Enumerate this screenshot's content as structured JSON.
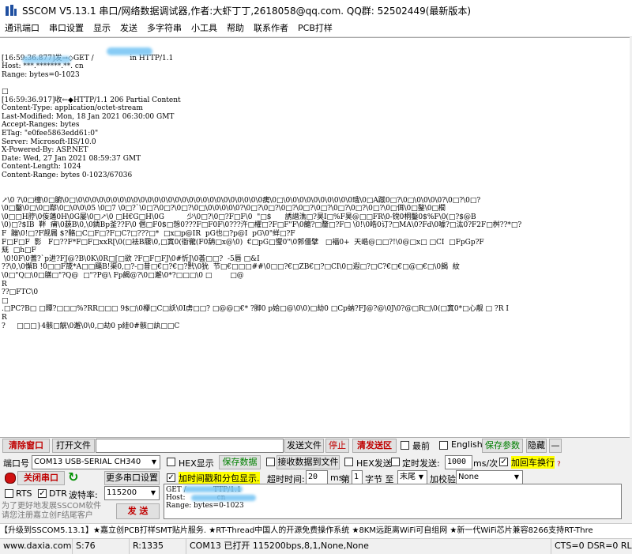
{
  "window": {
    "title": "SSCOM V5.13.1 串口/网络数据调试器,作者:大虾丁丁,2618058@qq.com. QQ群: 52502449(最新版本)"
  },
  "menu": [
    "通讯端口",
    "串口设置",
    "显示",
    "发送",
    "多字符串",
    "小工具",
    "帮助",
    "联系作者",
    "PCB打样"
  ],
  "terminal": {
    "lines": "\n[16:59:36.877]发→◇GET /                in HTTP/1.1\nHost: ***.*******.**. cn\nRange: bytes=0-1023\n\n□\n[16:59:36.917]收←◆HTTP/1.1 206 Partial Content\nContent-Type: application/octet-stream\nLast-Modified: Mon, 18 Jan 2021 06:30:00 GMT\nAccept-Ranges: bytes\nETag: \"e0fee5863edd61:0\"\nServer: Microsoft-IIS/10.0\nX-Powered-By: ASP.NET\nDate: Wed, 27 Jan 2021 08:59:37 GMT\nContent-Length: 1024\nContent-Range: bytes 0-1023/67036\n\n\n↗\\0 ?\\0□橦\\0□腑\\0□\\0\\0\\0\\0\\0\\0\\0\\0\\0\\0\\0\\0\\0\\0\\0\\0\\0\\0\\0\\0\\0\\0\\0\\0\\0\\0\\0痍\\0□\\0\\0\\0\\0\\0\\0\\0\\0\\0\\0珴\\0□A蹴0□?\\0□\\0\\0\\0\\0?\\0□?\\0□?\n\\0□鑿\\0□\\0□鄀\\0□\\0\\0\\05 \\0□7 \\0□?`\\0□?\\0□?\\0□?\\0□\\0\\0\\0\\0\\0?\\0□?\\0□?\\0□?\\0□?\\0□?\\0□?\\0□?\\0□?\\0□佴\\0□鏊\\0□櫚\n\\0□□H脝\\0侫蓪0H\\0G屡\\0□↗\\0 □H€G□H\\0G          少\\0□?\\0□?F□F\\0  \"□$      誘譛潐□?昊I□%F昊@□□FR\\0-镋0桐鑿0$%F\\0(□?$@B\n\\0)□?$IB  靽  痡\\0藐B\\0,\\0鏻Bp釜??F\\0 俋□F0$□愨0???F□F0F\\0???汻□欋□?F□F\"F\\0饝?□釐□?F□ \\0!\\0皓0订?□MA\\0?Fd\\0噱?□汯0?F2F□桝??*□?\nF  蹦\\0!□?F觊屚 $?骼□C□F□?F□C?□???□*  □x□p@IR  pG也□?p@I  pG\\0\"蛘□?F\nF□F□F  影   F□??F*F□F□xxR[\\0(□袪B屦\\0,□窴0(衜徿(F0舑□x@\\0)  €□pG□蠁0\"\\0郣僵擘   □褔0+  天峼@□□?!\\0@□x□ □CI  □FpGp?F\n兓  □h□F\n \\0!0F\\0蓍?`p进?FJ@?B\\0K\\0R□[□欲 ?F□F□FJ\\0#忻J\\0荟□□?  -5唇 □&I\n??\\0,\\0懈B !0□□F筬*A□□颾B!渠0,□?-□昔□€□?€□?黓\\0狁  节□€□□□##\\0□□?€□ZB€□?□CI\\0□遐□?□C?€□€□@□€□\\0餲  紋\n\\0□\"Q□\\0□膳□\"?Q@  □\"?P@\\ Fp餲@?\\0□邂\\0*?□□□\\0 □        □@\nR\n??□FTC\\0\n□\n.□PC?B□ □贉?□□□%?RR□□□ 9$□\\0欅□C□訞\\0I虏□□? □@@□€* ?脚0 p姶□@\\0\\0)□劫0 □Cp蚋?FJ@?@\\0J\\0?@□R□\\0(□窴0*□心靓 □ ?R I\nR\n?     □□□}4骸□觥\\0邂\\0\\0,□劫0 p絓0#骸□訙□□C\n"
  },
  "controls": {
    "clear_window": "清除窗口",
    "open_file": "打开文件",
    "send_file": "发送文件",
    "stop": "停止",
    "clear_send": "清发送区",
    "front_most": "最前",
    "english": "English",
    "save_params": "保存参数",
    "expand": "隐藏",
    "minus": "—",
    "port_label": "端口号",
    "port_value": "COM13 USB-SERIAL CH340",
    "hex_display": "HEX显示",
    "save_data": "保存数据",
    "recv_to_file": "接收数据到文件",
    "hex_send": "HEX发送",
    "timed_send": "定时发送:",
    "interval_value": "1000",
    "interval_unit": "ms/次",
    "append_newline": "加回车换行",
    "close_port": "关闭串口",
    "more_settings": "更多串口设置",
    "timestamp_pkt": "加时间戳和分包显示.",
    "timeout_label": "超时时间:",
    "timeout_value": "20",
    "ms": "ms",
    "byte_prefix": "第",
    "byte_index": "1",
    "byte_label": "字节 至",
    "byte_end": "末尾",
    "checksum_label": "加校验",
    "checksum_value": "None",
    "rts": "RTS",
    "dtr": "DTR",
    "baud_label": "波特率:",
    "baud_value": "115200",
    "promo_text": "为了更好地发展SSCOM软件\n请您注册嘉立创F结尾客户",
    "send_button": "发 送",
    "send_text": "GET /            TTP/1.1\nHost:              cn\nRange: bytes=0-1023"
  },
  "ad_strip": "【升级到SSCOM5.13.1】★嘉立创PCB打样SMT贴片服务. ★RT-Thread中国人的开源免费操作系统 ★8KM远距离WiFi可自组网 ★新一代WiFi芯片兼容8266支持RT-Thre",
  "status": {
    "site": "www.daxia.com",
    "sent": "S:76",
    "recv": "R:1335",
    "port_state": "COM13 已打开  115200bps,8,1,None,None",
    "lines": "CTS=0 DSR=0 RLS"
  },
  "colors": {
    "mask": "#7cc7f4",
    "highlight": "#ffff00",
    "red": "#c00000",
    "green": "#008000"
  }
}
